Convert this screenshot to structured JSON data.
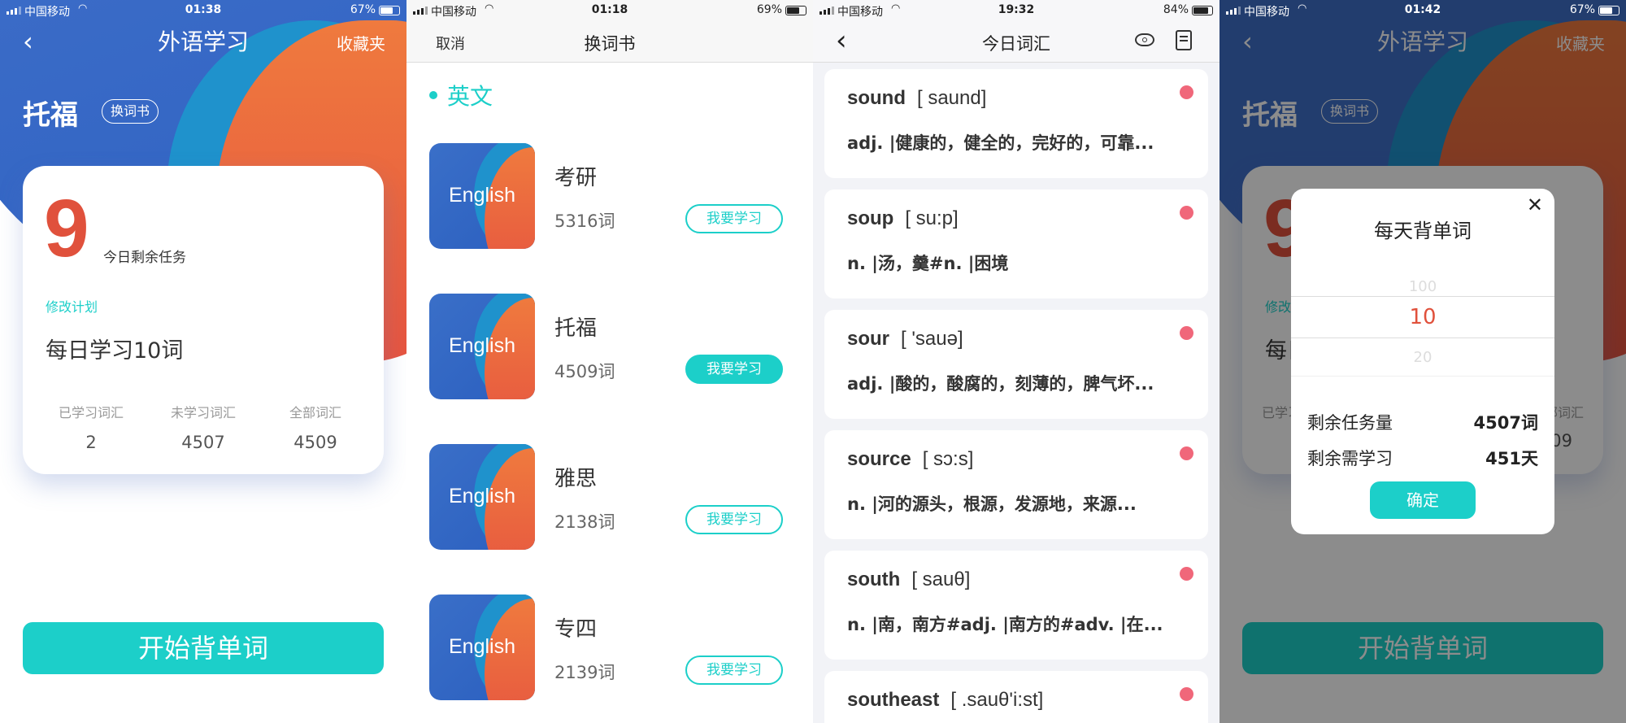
{
  "colors": {
    "accent": "#1ccfc9",
    "red": "#e0513c",
    "blue": "#3a6fc8",
    "orange": "#ec6a3c",
    "dot": "#f0677a"
  },
  "panel1": {
    "status": {
      "carrier": "中国移动",
      "time": "01:38",
      "battery": "67%",
      "battery_level": 0.67
    },
    "title": "外语学习",
    "favorites": "收藏夹",
    "book": "托福",
    "change_book": "换词书",
    "remaining_count": "9",
    "remaining_label": "今日剩余任务",
    "edit_plan": "修改计划",
    "plan": "每日学习10词",
    "stats": [
      {
        "label": "已学习词汇",
        "value": "2"
      },
      {
        "label": "未学习词汇",
        "value": "4507"
      },
      {
        "label": "全部词汇",
        "value": "4509"
      }
    ],
    "start": "开始背单词"
  },
  "panel2": {
    "status": {
      "carrier": "中国移动",
      "time": "01:18",
      "battery": "69%",
      "battery_level": 0.69
    },
    "cancel": "取消",
    "title": "换词书",
    "section": "英文",
    "books": [
      {
        "cover": "English",
        "name": "考研",
        "count": "5316词",
        "button": "我要学习",
        "selected": false
      },
      {
        "cover": "English",
        "name": "托福",
        "count": "4509词",
        "button": "我要学习",
        "selected": true
      },
      {
        "cover": "English",
        "name": "雅思",
        "count": "2138词",
        "button": "我要学习",
        "selected": false
      },
      {
        "cover": "English",
        "name": "专四",
        "count": "2139词",
        "button": "我要学习",
        "selected": false
      }
    ]
  },
  "panel3": {
    "status": {
      "carrier": "中国移动",
      "time": "19:32",
      "battery": "84%",
      "battery_level": 0.84
    },
    "title": "今日词汇",
    "words": [
      {
        "word": "sound",
        "phonetic": "[ saund]",
        "def": "adj. |健康的，健全的，完好的，可靠..."
      },
      {
        "word": "soup",
        "phonetic": "[ su:p]",
        "def": "n. |汤，羹#n. |困境"
      },
      {
        "word": "sour",
        "phonetic": "[ 'sauə]",
        "def": "adj. |酸的，酸腐的，刻薄的，脾气坏..."
      },
      {
        "word": "source",
        "phonetic": "[ sɔ:s]",
        "def": "n. |河的源头，根源，发源地，来源..."
      },
      {
        "word": "south",
        "phonetic": "[ sauθ]",
        "def": "n. |南，南方#adj. |南方的#adv. |在..."
      },
      {
        "word": "southeast",
        "phonetic": "[ .sauθ'i:st]",
        "def": ""
      }
    ]
  },
  "panel4": {
    "status": {
      "carrier": "中国移动",
      "time": "01:42",
      "battery": "67%",
      "battery_level": 0.67
    },
    "modal": {
      "title": "每天背单词",
      "picker": [
        "100",
        "10",
        "20"
      ],
      "selected": "10",
      "rows": [
        {
          "label": "剩余任务量",
          "value": "4507词"
        },
        {
          "label": "剩余需学习",
          "value": "451天"
        }
      ],
      "confirm": "确定"
    }
  }
}
